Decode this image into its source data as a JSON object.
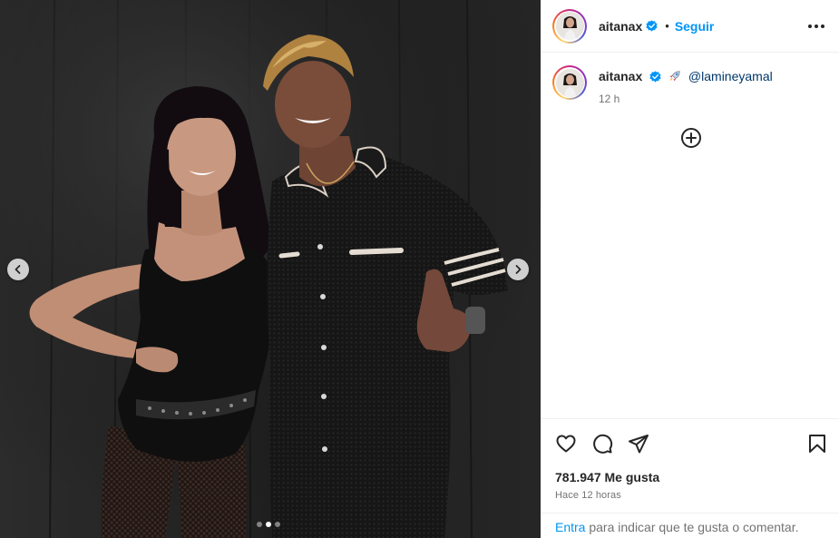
{
  "post": {
    "username": "aitanax",
    "follow_label": "Seguir",
    "header_separator": "•",
    "caption_mention": "@lamineyamal",
    "caption_time": "12 h",
    "likes": "781.947 Me gusta",
    "time_ago": "Hace 12 horas",
    "carousel_total": 3,
    "carousel_index": 2
  },
  "login_prompt": {
    "link": "Entra",
    "text": " para indicar que te gusta o comentar."
  },
  "icons": {
    "verified": "verified-badge-icon",
    "more": "more-options-icon",
    "add": "add-circle-icon",
    "like": "heart-icon",
    "comment": "comment-icon",
    "share": "share-icon",
    "save": "bookmark-icon",
    "rocket": "rocket-emoji-icon",
    "prev": "chevron-left-icon",
    "next": "chevron-right-icon"
  },
  "colors": {
    "accent": "#0095f6",
    "verified": "#0095f6",
    "mention": "#00376b",
    "muted": "#737373",
    "text": "#262626"
  }
}
